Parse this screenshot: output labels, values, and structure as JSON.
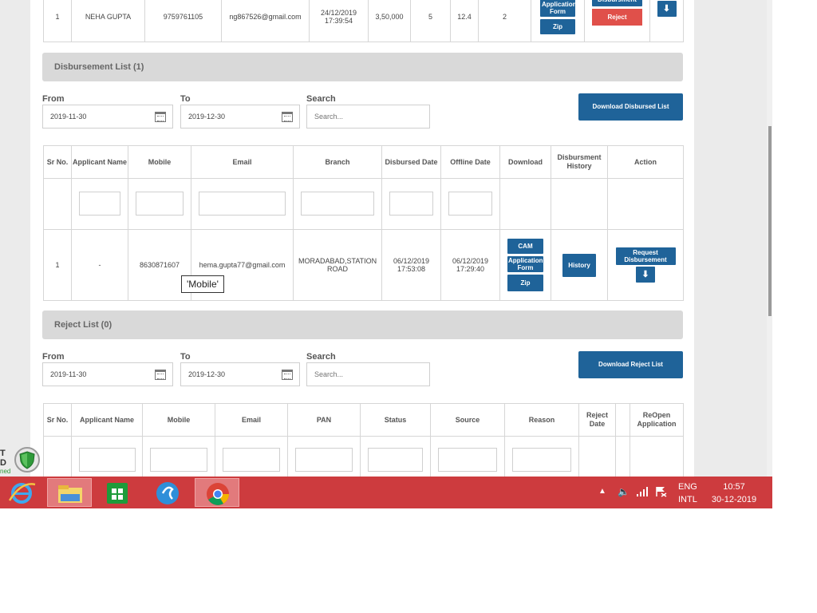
{
  "top_table": {
    "row": {
      "sr": "1",
      "name": "NEHA GUPTA",
      "mobile": "9759761105",
      "email": "ng867526@gmail.com",
      "date1": "24/12/2019",
      "date2": "17:39:54",
      "amount": "3,50,000",
      "col6": "5",
      "col7": "12.4",
      "col8": "2",
      "btn_application": "Application Form",
      "btn_zip": "Zip",
      "btn_disbursement": "Disbursment",
      "btn_reject": "Reject"
    }
  },
  "disbursement": {
    "title": "Disbursement List (1)",
    "from_label": "From",
    "to_label": "To",
    "search_label": "Search",
    "from_value": "2019-11-30",
    "to_value": "2019-12-30",
    "search_placeholder": "Search...",
    "download_button": "Download Disbursed List",
    "headers": [
      "Sr No.",
      "Applicant Name",
      "Mobile",
      "Email",
      "Branch",
      "Disbursed Date",
      "Offline Date",
      "Download",
      "Disbursment History",
      "Action"
    ],
    "row": {
      "sr": "1",
      "name": "-",
      "mobile": "8630871607",
      "email": "hema.gupta77@gmail.com",
      "branch": "MORADABAD,STATION ROAD",
      "disbursed_date": "06/12/2019",
      "disbursed_time": "17:53:08",
      "offline_date": "06/12/2019",
      "offline_time": "17:29:40",
      "btn_cam": "CAM",
      "btn_application": "Application Form",
      "btn_zip": "Zip",
      "btn_history": "History",
      "btn_request": "Request Disbursement"
    },
    "tooltip": "'Mobile'"
  },
  "reject": {
    "title": "Reject List (0)",
    "from_label": "From",
    "to_label": "To",
    "search_label": "Search",
    "from_value": "2019-11-30",
    "to_value": "2019-12-30",
    "search_placeholder": "Search...",
    "download_button": "Download Reject List",
    "headers": [
      "Sr No.",
      "Applicant Name",
      "Mobile",
      "Email",
      "PAN",
      "Status",
      "Source",
      "Reason",
      "Reject Date",
      "",
      "ReOpen Application"
    ]
  },
  "taskbar": {
    "language": "ENG",
    "layout": "INTL",
    "time": "10:57",
    "date": "30-12-2019",
    "td_text": "ned",
    "colors": {
      "taskbar": "#cd3b3e",
      "button_blue": "#1f6399",
      "button_red": "#e0504a"
    }
  }
}
